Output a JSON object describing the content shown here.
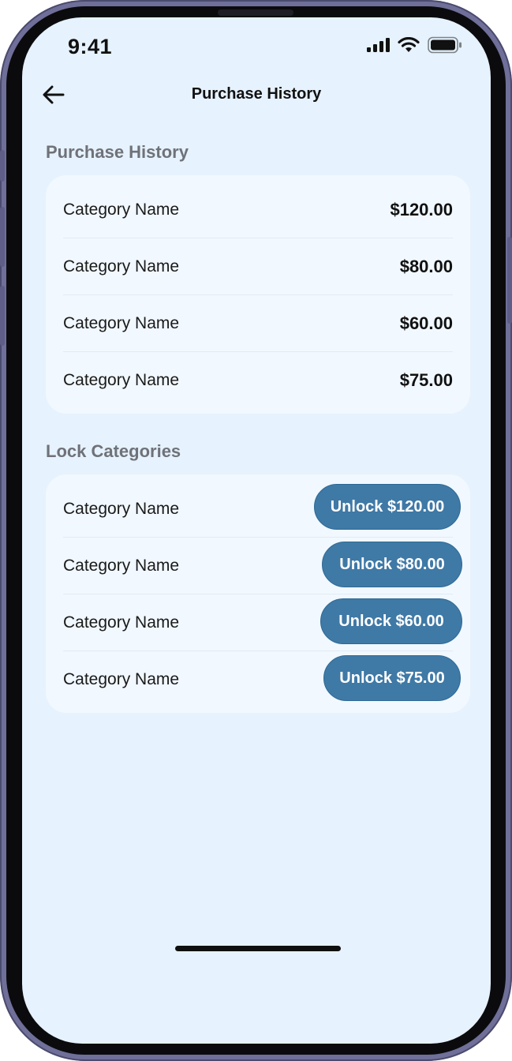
{
  "status_bar": {
    "time": "9:41",
    "signal_icon": "cellular-signal-icon",
    "wifi_icon": "wifi-icon",
    "battery_icon": "battery-icon"
  },
  "header": {
    "back_icon": "arrow-left-icon",
    "title": "Purchase History"
  },
  "purchase_history": {
    "title": "Purchase History",
    "items": [
      {
        "name": "Category Name",
        "price": "$120.00"
      },
      {
        "name": "Category Name",
        "price": "$80.00"
      },
      {
        "name": "Category Name",
        "price": "$60.00"
      },
      {
        "name": "Category Name",
        "price": "$75.00"
      }
    ]
  },
  "lock_categories": {
    "title": "Lock Categories",
    "items": [
      {
        "name": "Category Name",
        "button": "Unlock $120.00"
      },
      {
        "name": "Category Name",
        "button": "Unlock $80.00"
      },
      {
        "name": "Category Name",
        "button": "Unlock $60.00"
      },
      {
        "name": "Category Name",
        "button": "Unlock $75.00"
      }
    ]
  },
  "colors": {
    "background": "#e6f2fd",
    "card": "#f1f8ff",
    "accent": "#3f79a6",
    "section_title": "#6f7278",
    "frame": "#6f6f9a"
  }
}
